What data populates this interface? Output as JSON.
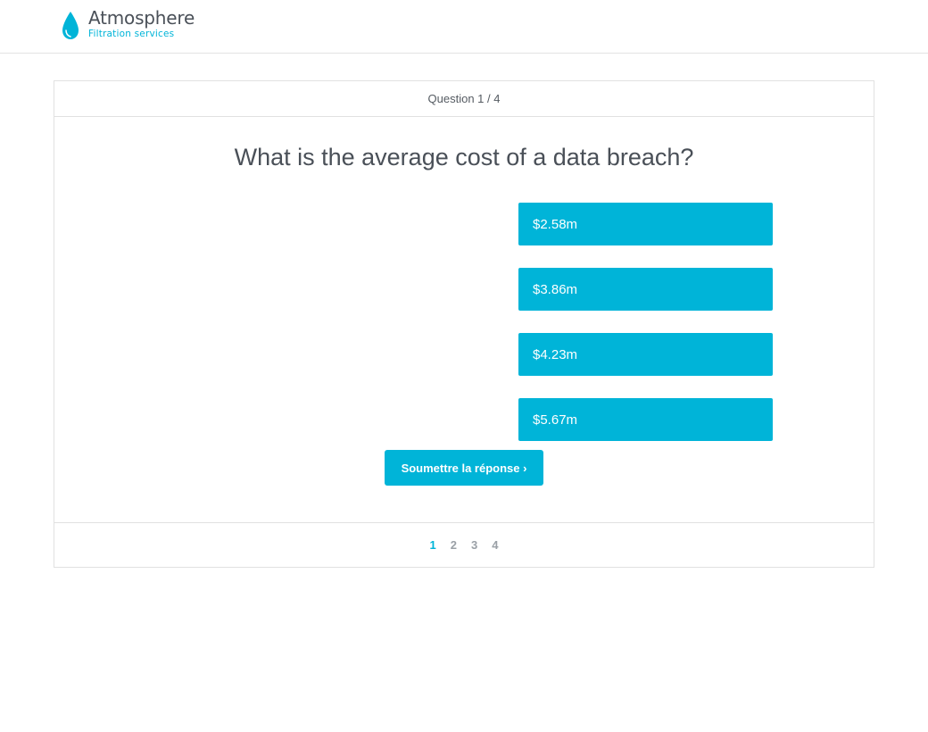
{
  "brand": {
    "title": "Atmosphere",
    "subtitle": "Filtration services",
    "icon": "water-drop-icon",
    "accent_color": "#00b4d8"
  },
  "quiz": {
    "progress_label": "Question 1 / 4",
    "question": "What is the average cost of a data breach?",
    "answers": [
      {
        "label": "$2.58m"
      },
      {
        "label": "$3.86m"
      },
      {
        "label": "$4.23m"
      },
      {
        "label": "$5.67m"
      }
    ],
    "submit_label": "Soumettre la réponse ›",
    "pagination": [
      "1",
      "2",
      "3",
      "4"
    ],
    "current_page": "1"
  }
}
